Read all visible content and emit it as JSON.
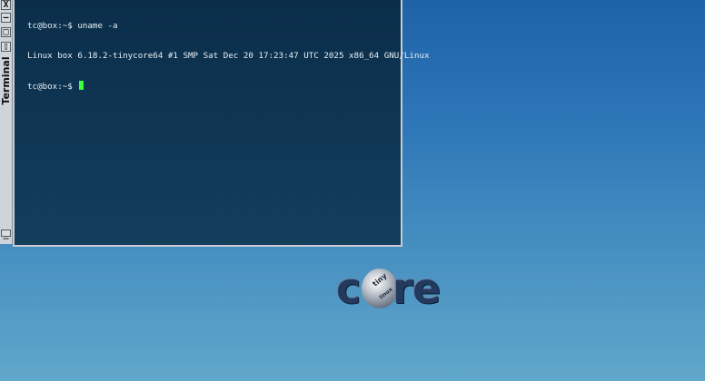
{
  "window": {
    "title": "Terminal",
    "close_glyph": "X",
    "minimize_glyph": "—",
    "maximize_glyph": "□",
    "shade_glyph": "▯",
    "bottom_glyph": "_"
  },
  "terminal": {
    "lines": [
      "tc@box:~$ uname -a",
      "Linux box 6.18.2-tinycore64 #1 SMP Sat Dec 20 17:23:47 UTC 2025 x86_64 GNU/Linux",
      "tc@box:~$ "
    ],
    "cursor_color": "#3dff3d",
    "background_color": "#0f3553"
  },
  "logo": {
    "letter_c": "c",
    "letter_r": "r",
    "letter_e": "e",
    "tiny": "tiny",
    "linux": "linux"
  }
}
